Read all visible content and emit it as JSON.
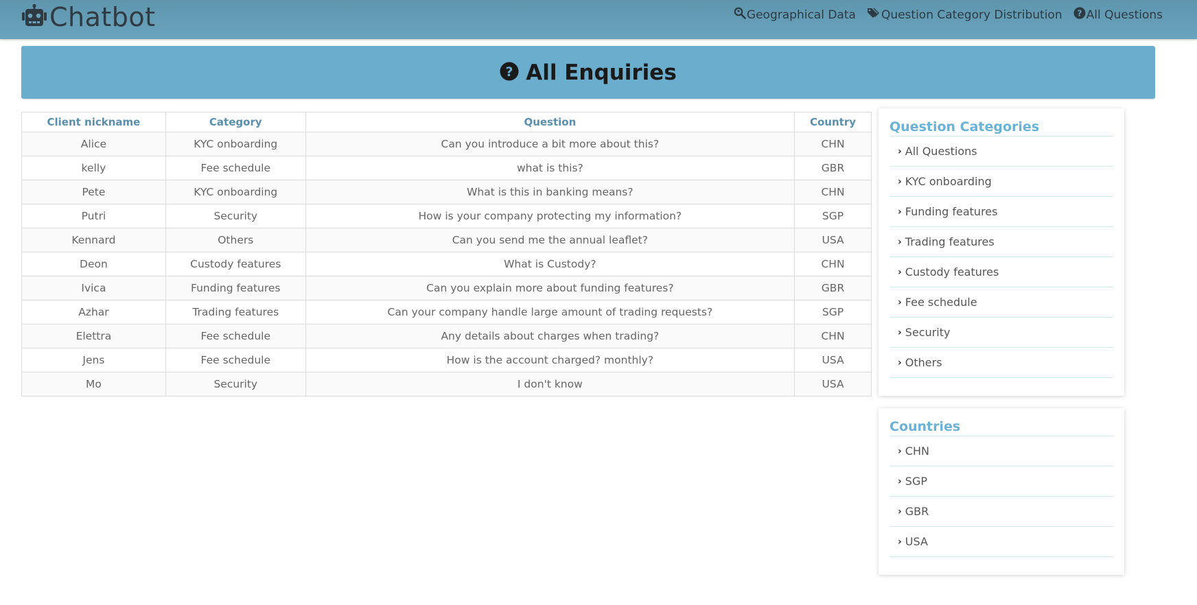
{
  "navbar": {
    "brand": "Chatbot",
    "links": [
      {
        "label": "Geographical Data",
        "icon": "search-location-icon"
      },
      {
        "label": "Question Category Distribution",
        "icon": "tags-icon"
      },
      {
        "label": "All Questions",
        "icon": "question-circle-icon"
      }
    ]
  },
  "banner": {
    "title": "All Enquiries",
    "icon": "question-circle-icon"
  },
  "table": {
    "headers": [
      "Client nickname",
      "Category",
      "Question",
      "Country"
    ],
    "rows": [
      [
        "Alice",
        "KYC onboarding",
        "Can you introduce a bit more about this?",
        "CHN"
      ],
      [
        "kelly",
        "Fee schedule",
        "what is this?",
        "GBR"
      ],
      [
        "Pete",
        "KYC onboarding",
        "What is this in banking means?",
        "CHN"
      ],
      [
        "Putri",
        "Security",
        "How is your company protecting my information?",
        "SGP"
      ],
      [
        "Kennard",
        "Others",
        "Can you send me the annual leaflet?",
        "USA"
      ],
      [
        "Deon",
        "Custody features",
        "What is Custody?",
        "CHN"
      ],
      [
        "Ivica",
        "Funding features",
        "Can you explain more about funding features?",
        "GBR"
      ],
      [
        "Azhar",
        "Trading features",
        "Can your company handle large amount of trading requests?",
        "SGP"
      ],
      [
        "Elettra",
        "Fee schedule",
        "Any details about charges when trading?",
        "CHN"
      ],
      [
        "Jens",
        "Fee schedule",
        "How is the account charged? monthly?",
        "USA"
      ],
      [
        "Mo",
        "Security",
        "I don't know",
        "USA"
      ]
    ]
  },
  "categories_panel": {
    "title": "Question Categories",
    "items": [
      "All Questions",
      "KYC onboarding",
      "Funding features",
      "Trading features",
      "Custody features",
      "Fee schedule",
      "Security",
      "Others"
    ]
  },
  "countries_panel": {
    "title": "Countries",
    "items": [
      "CHN",
      "SGP",
      "GBR",
      "USA"
    ]
  },
  "colors": {
    "navbar": "#6aa3bd",
    "banner": "#6aadcc",
    "panel_title": "#6ab2d6",
    "table_header": "#5a8fae"
  }
}
